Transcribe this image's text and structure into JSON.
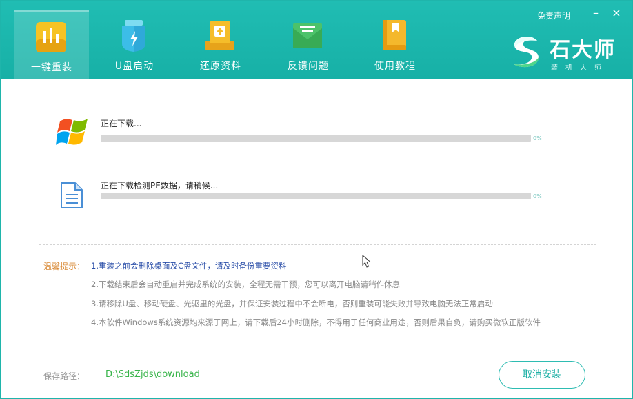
{
  "nav": {
    "items": [
      {
        "label": "一键重装",
        "icon": "bar-chart-icon"
      },
      {
        "label": "U盘启动",
        "icon": "usb-drive-icon"
      },
      {
        "label": "还原资料",
        "icon": "restore-box-icon"
      },
      {
        "label": "反馈问题",
        "icon": "envelope-icon"
      },
      {
        "label": "使用教程",
        "icon": "book-icon"
      }
    ],
    "active_index": 0
  },
  "header": {
    "disclaimer": "免责声明",
    "minimize": "–",
    "close": "×"
  },
  "brand": {
    "title": "石大师",
    "subtitle": "装机大师"
  },
  "tasks": [
    {
      "label": "正在下载...",
      "percent_text": "0%",
      "progress": 0,
      "icon": "windows-logo-icon"
    },
    {
      "label": "正在下载检测PE数据，请稍候...",
      "percent_text": "0%",
      "progress": 0,
      "icon": "document-icon"
    }
  ],
  "tips": {
    "title": "温馨提示：",
    "items": [
      "1.重装之前会删除桌面及C盘文件，请及时备份重要资料",
      "2.下载结束后会自动重启并完成系统的安装，全程无需干预，您可以离开电脑请稍作休息",
      "3.请移除U盘、移动硬盘、光驱里的光盘，并保证安装过程中不会断电，否则重装可能失败并导致电脑无法正常启动",
      "4.本软件Windows系统资源均来源于网上，请下载后24小时删除，不得用于任何商业用途，否则后果自负，请购买微软正版软件"
    ]
  },
  "footer": {
    "save_label": "保存路径：",
    "save_path": "D:\\SdsZjds\\download",
    "cancel_label": "取消安装"
  },
  "colors": {
    "accent": "#1fb5ab",
    "tips_title": "#d98a36",
    "first_tip": "#2a4ea8",
    "path": "#38b44a"
  }
}
